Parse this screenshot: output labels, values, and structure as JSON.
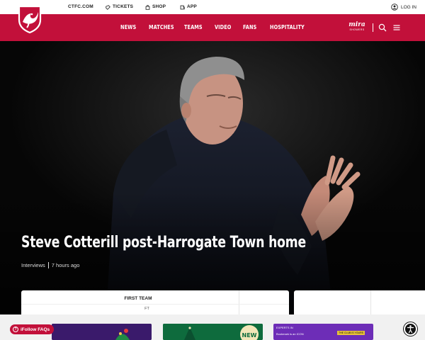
{
  "top_bar": {
    "site_link": "CTFC.COM",
    "links": [
      {
        "label": "TICKETS",
        "icon": "ticket-icon"
      },
      {
        "label": "SHOP",
        "icon": "shopping-bag-icon"
      },
      {
        "label": "APP",
        "icon": "app-icon"
      }
    ],
    "login_label": "LOG IN",
    "login_icon": "user-icon"
  },
  "nav": {
    "logo": "club-crest",
    "items": [
      "NEWS",
      "MATCHES",
      "TEAMS",
      "VIDEO",
      "FANS",
      "HOSPITALITY"
    ],
    "sponsor_name": "mira",
    "sponsor_sub": "SHOWERS",
    "icons": [
      "search-icon",
      "menu-icon"
    ]
  },
  "hero": {
    "title": "Steve Cotterill post-Harrogate Town home",
    "category": "Interviews",
    "time": "7 hours ago"
  },
  "fixture": {
    "label": "FIRST TEAM",
    "status": "FT"
  },
  "promos": [
    {
      "name": "promo-1"
    },
    {
      "name": "promo-2",
      "badge": "NEW"
    },
    {
      "name": "promo-3",
      "line1": "EXPERTS IN",
      "line2": "Bookmark is an ICON",
      "tag": "THE CLUB IS YOURS"
    }
  ],
  "faq_button": "iFollow FAQs",
  "colors": {
    "brand_red": "#c2103a",
    "hero_bg": "#060606",
    "white": "#ffffff"
  }
}
